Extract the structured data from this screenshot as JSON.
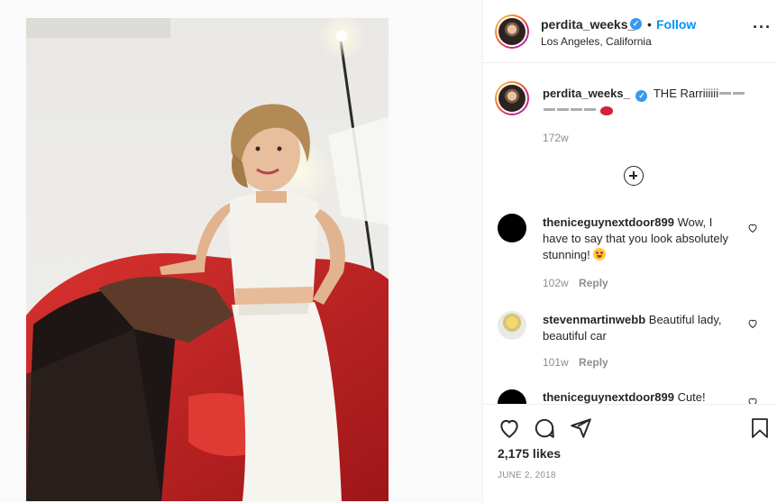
{
  "post": {
    "image_alt": "Woman in white outfit posing next to red sports car",
    "colors": {
      "car_red": "#c8282a",
      "outfit_white": "#f4f2ec",
      "hair": "#b38a55"
    }
  },
  "header": {
    "username": "perdita_weeks_",
    "verified_icon": "verified-badge-icon",
    "separator": "•",
    "follow_label": "Follow",
    "location": "Los Angeles, California",
    "more_label": "•••"
  },
  "caption": {
    "username": "perdita_weeks_",
    "text": "THE Rarriiiiii",
    "time": "172w"
  },
  "load_more_icon": "plus-circle-icon",
  "comments": [
    {
      "username": "theniceguynextdoor899",
      "text": "Wow, I have to say that you look absolutely stunning!",
      "time": "102w",
      "reply": "Reply"
    },
    {
      "username": "stevenmartinwebb",
      "text": "Beautiful lady, beautiful car",
      "time": "101w",
      "reply": "Reply"
    },
    {
      "username": "theniceguynextdoor899",
      "text": "Cute!",
      "time": "",
      "reply": ""
    }
  ],
  "actions": {
    "like_icon": "heart-icon",
    "comment_icon": "comment-icon",
    "share_icon": "paper-plane-icon",
    "save_icon": "bookmark-icon",
    "likes": "2,175 likes",
    "date": "JUNE 2, 2018"
  },
  "colors": {
    "link_blue": "#0095f6",
    "text": "#262626",
    "muted": "#8e8e8e",
    "border": "#efefef"
  }
}
